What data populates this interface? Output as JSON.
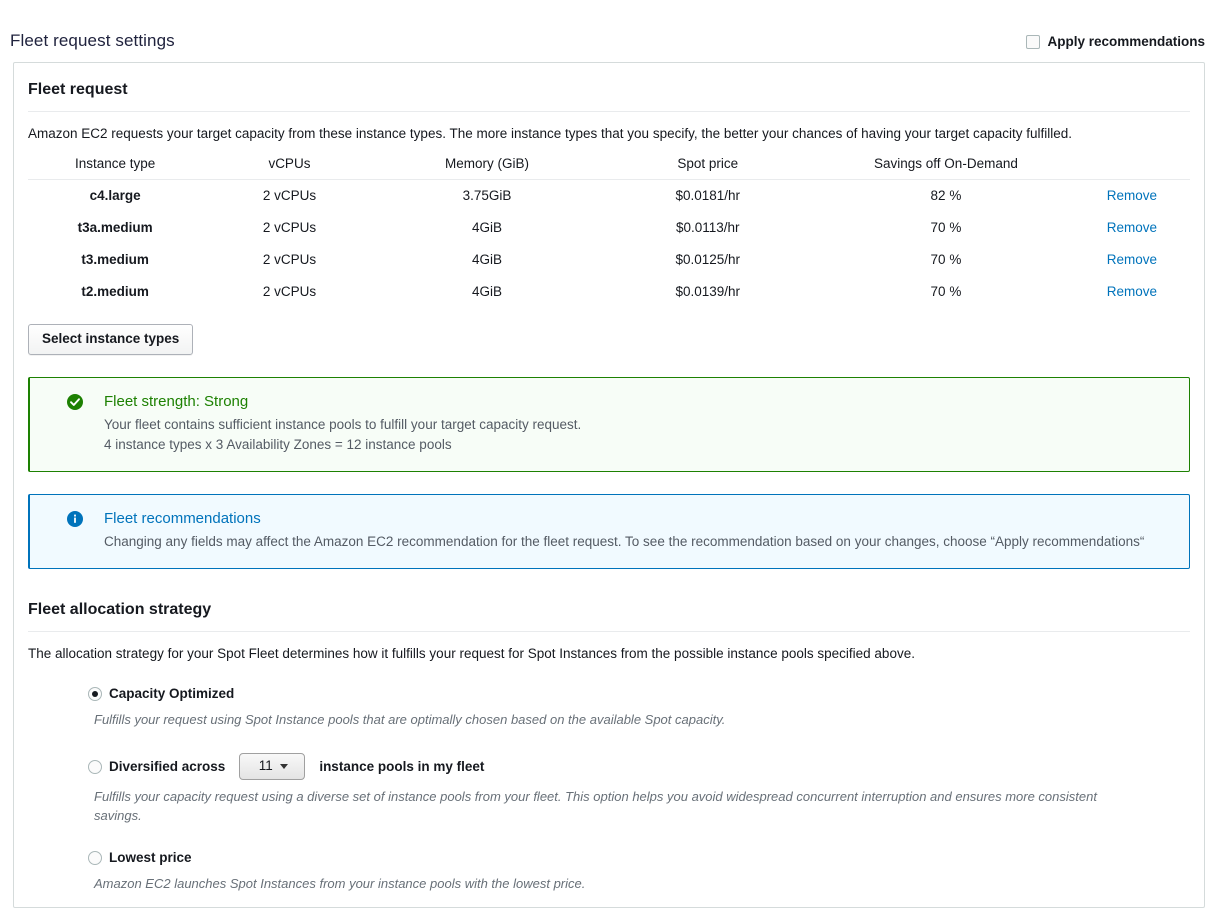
{
  "header": {
    "title": "Fleet request settings",
    "apply_recommendations_label": "Apply recommendations",
    "apply_recommendations_checked": false
  },
  "fleet_request": {
    "title": "Fleet request",
    "description": "Amazon EC2 requests your target capacity from these instance types. The more instance types that you specify, the better your chances of having your target capacity fulfilled.",
    "columns": [
      "Instance type",
      "vCPUs",
      "Memory (GiB)",
      "Spot price",
      "Savings off On-Demand",
      ""
    ],
    "rows": [
      {
        "instance_type": "c4.large",
        "vcpus": "2 vCPUs",
        "memory": "3.75GiB",
        "spot_price": "$0.0181/hr",
        "savings": "82 %",
        "action": "Remove"
      },
      {
        "instance_type": "t3a.medium",
        "vcpus": "2 vCPUs",
        "memory": "4GiB",
        "spot_price": "$0.0113/hr",
        "savings": "70 %",
        "action": "Remove"
      },
      {
        "instance_type": "t3.medium",
        "vcpus": "2 vCPUs",
        "memory": "4GiB",
        "spot_price": "$0.0125/hr",
        "savings": "70 %",
        "action": "Remove"
      },
      {
        "instance_type": "t2.medium",
        "vcpus": "2 vCPUs",
        "memory": "4GiB",
        "spot_price": "$0.0139/hr",
        "savings": "70 %",
        "action": "Remove"
      }
    ],
    "select_instance_types_label": "Select instance types"
  },
  "fleet_strength_alert": {
    "icon": "check-circle-icon",
    "heading": "Fleet strength: Strong",
    "line1": "Your fleet contains sufficient instance pools to fulfill your target capacity request.",
    "line2": "4 instance types x 3 Availability Zones = 12 instance pools",
    "accent_color": "#1d8102",
    "background_color": "#f7fdf7"
  },
  "fleet_recommendations_alert": {
    "icon": "info-circle-icon",
    "heading": "Fleet recommendations",
    "text": "Changing any fields may affect the Amazon EC2 recommendation for the fleet request. To see the recommendation based on your changes, choose “Apply recommendations“",
    "accent_color": "#0073bb",
    "background_color": "#f1faff"
  },
  "allocation_strategy": {
    "title": "Fleet allocation strategy",
    "description": "The allocation strategy for your Spot Fleet determines how it fulfills your request for Spot Instances from the possible instance pools specified above.",
    "options": [
      {
        "label": "Capacity Optimized",
        "selected": true,
        "description": "Fulfills your request using Spot Instance pools that are optimally chosen based on the available Spot capacity."
      },
      {
        "label": "Diversified across",
        "label_suffix": "instance pools in my fleet",
        "selected": false,
        "pool_count": "11",
        "description": "Fulfills your capacity request using a diverse set of instance pools from your fleet. This option helps you avoid widespread concurrent interruption and ensures more consistent savings."
      },
      {
        "label": "Lowest price",
        "selected": false,
        "description": "Amazon EC2 launches Spot Instances from your instance pools with the lowest price."
      }
    ]
  },
  "colors": {
    "link": "#0073bb",
    "success": "#1d8102",
    "info": "#0073bb",
    "text": "#16191f",
    "muted": "#545b64",
    "border": "#d5dbdb"
  }
}
